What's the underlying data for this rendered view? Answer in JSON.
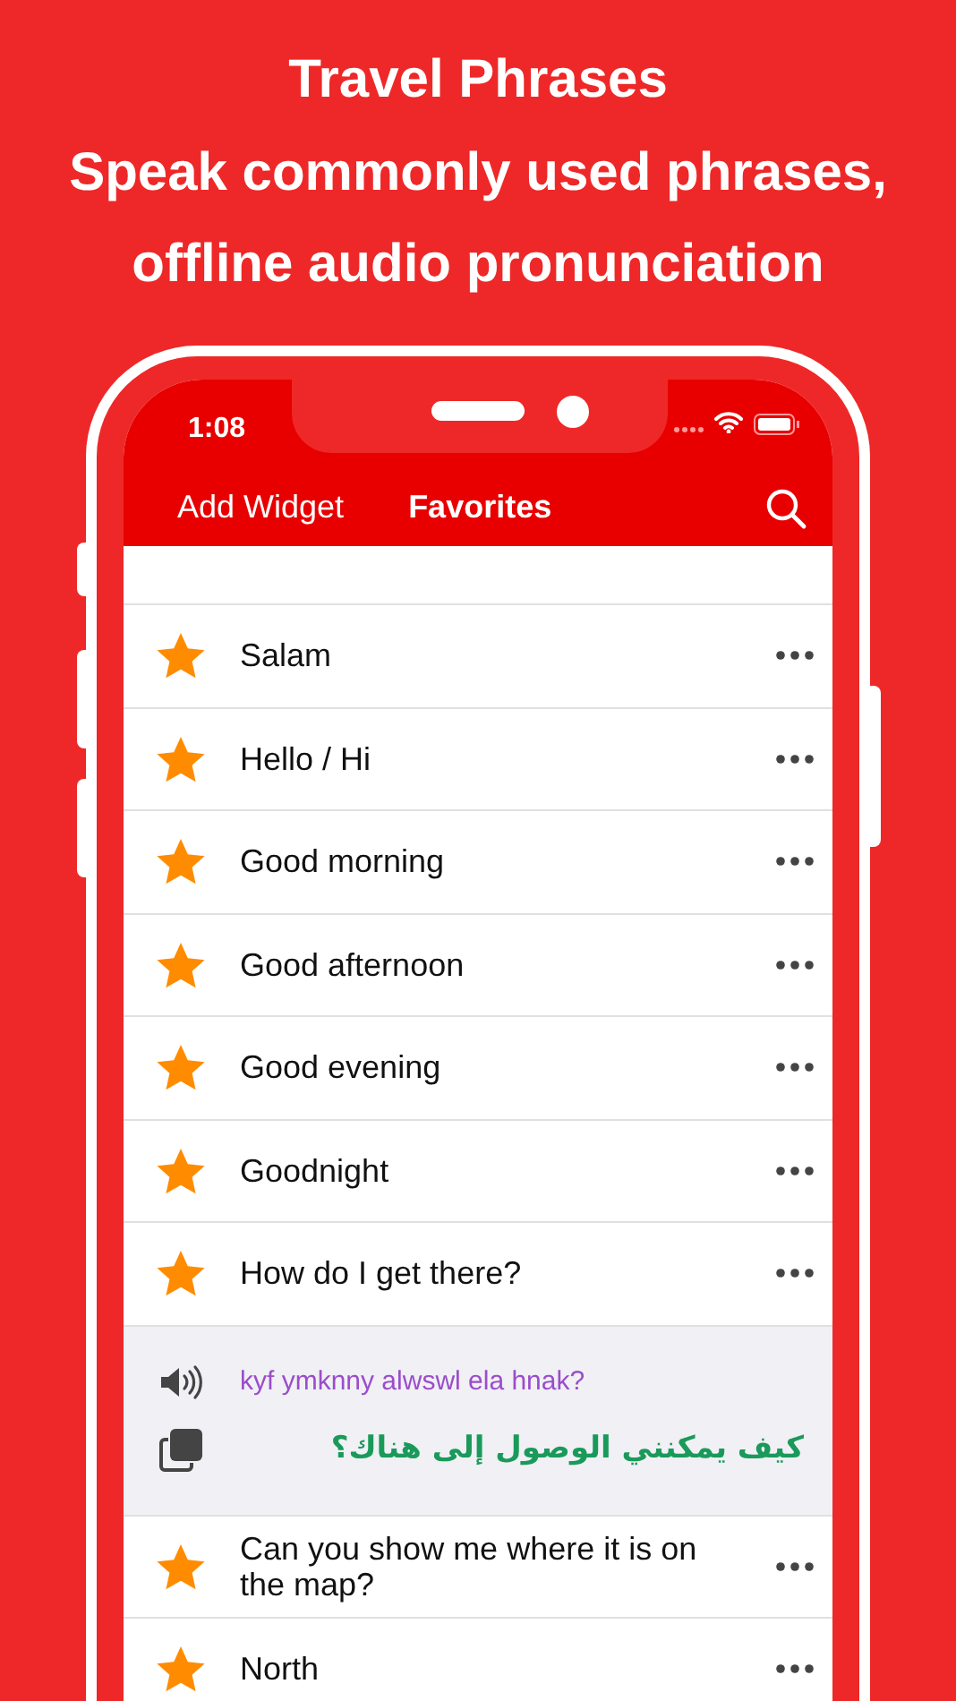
{
  "headline": [
    "Travel Phrases",
    "Speak commonly used phrases,",
    "offline audio pronunciation"
  ],
  "status_bar": {
    "time": "1:08"
  },
  "tabs": [
    {
      "label": "Add Widget",
      "selected": false
    },
    {
      "label": "Favorites",
      "selected": true
    }
  ],
  "phrases": [
    {
      "text": "Salam",
      "favorite": true,
      "expanded": false
    },
    {
      "text": "Hello / Hi",
      "favorite": true,
      "expanded": false
    },
    {
      "text": "Good morning",
      "favorite": true,
      "expanded": false
    },
    {
      "text": "Good afternoon",
      "favorite": true,
      "expanded": false
    },
    {
      "text": "Good evening",
      "favorite": true,
      "expanded": false
    },
    {
      "text": "Goodnight",
      "favorite": true,
      "expanded": false
    },
    {
      "text": "How do I get there?",
      "favorite": true,
      "expanded": true,
      "transliteration": "kyf ymknny alwswl ela hnak?",
      "translation": "كيف يمكنني الوصول إلى هناك؟"
    },
    {
      "text": "Can you show me where it is on the map?",
      "favorite": true,
      "expanded": false
    },
    {
      "text": "North",
      "favorite": true,
      "expanded": false
    }
  ]
}
